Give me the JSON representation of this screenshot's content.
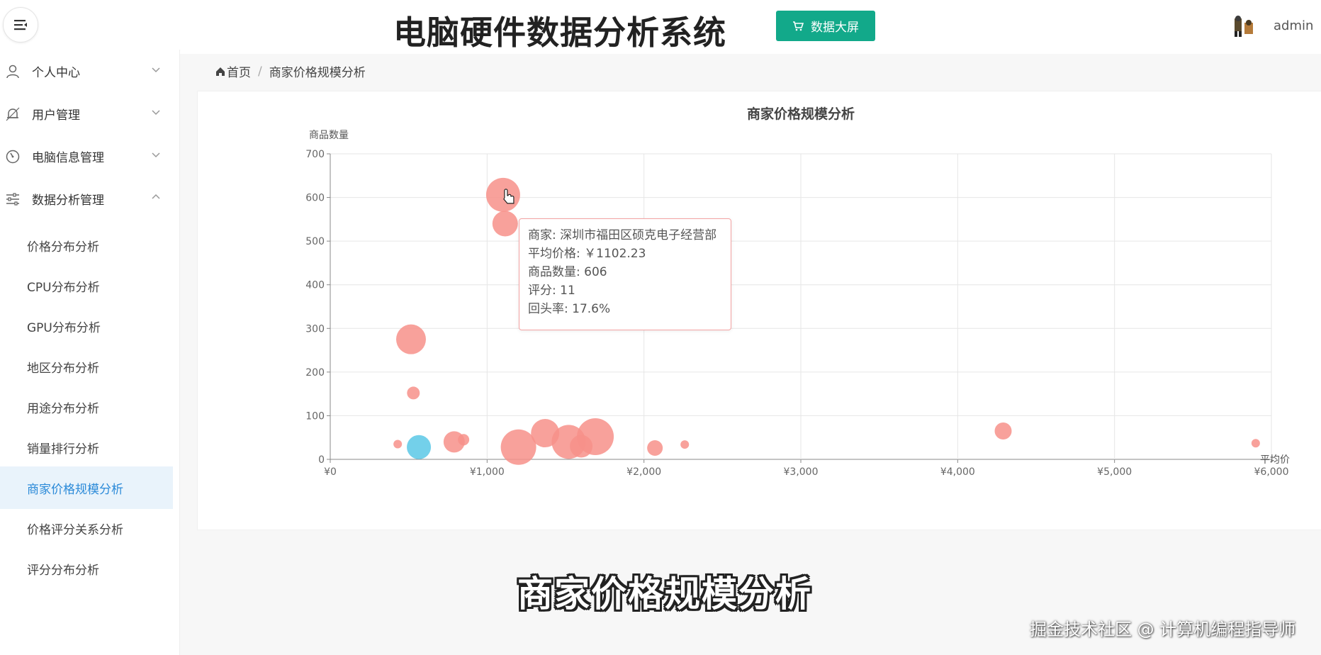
{
  "header": {
    "title": "电脑硬件数据分析系统",
    "bigscreen_label": "数据大屏",
    "username": "admin"
  },
  "sidebar": {
    "groups": [
      {
        "label": "个人中心",
        "icon": "user-icon",
        "expanded": false
      },
      {
        "label": "用户管理",
        "icon": "bell-icon",
        "expanded": false
      },
      {
        "label": "电脑信息管理",
        "icon": "gauge-icon",
        "expanded": false
      },
      {
        "label": "数据分析管理",
        "icon": "sliders-icon",
        "expanded": true
      }
    ],
    "items": [
      {
        "label": "价格分布分析"
      },
      {
        "label": "CPU分布分析"
      },
      {
        "label": "GPU分布分析"
      },
      {
        "label": "地区分布分析"
      },
      {
        "label": "用途分布分析"
      },
      {
        "label": "销量排行分析"
      },
      {
        "label": "商家价格规模分析",
        "active": true
      },
      {
        "label": "价格评分关系分析"
      },
      {
        "label": "评分分布分析"
      }
    ]
  },
  "breadcrumb": {
    "home": "首页",
    "current": "商家价格规模分析"
  },
  "colors": {
    "accent": "#12a98a",
    "bubble": "#f7908a",
    "highlight_bubble": "#5bc8e6",
    "active_menu": "#2b8ad8"
  },
  "chart_data": {
    "type": "scatter",
    "title": "商家价格规模分析",
    "xlabel": "平均价",
    "ylabel": "商品数量",
    "xlim": [
      0,
      6000
    ],
    "ylim": [
      0,
      700
    ],
    "xticks": [
      "¥0",
      "¥1,000",
      "¥2,000",
      "¥3,000",
      "¥4,000",
      "¥5,000",
      "¥6,000"
    ],
    "yticks": [
      "0",
      "100",
      "200",
      "300",
      "400",
      "500",
      "600",
      "700"
    ],
    "grid": true,
    "points": [
      {
        "x": 1102,
        "y": 606,
        "size": 24
      },
      {
        "x": 1115,
        "y": 540,
        "size": 18
      },
      {
        "x": 515,
        "y": 275,
        "size": 21
      },
      {
        "x": 530,
        "y": 152,
        "size": 9
      },
      {
        "x": 430,
        "y": 35,
        "size": 6
      },
      {
        "x": 565,
        "y": 28,
        "size": 17,
        "highlight": true
      },
      {
        "x": 790,
        "y": 40,
        "size": 15
      },
      {
        "x": 850,
        "y": 45,
        "size": 8
      },
      {
        "x": 1200,
        "y": 28,
        "size": 25
      },
      {
        "x": 1370,
        "y": 60,
        "size": 20
      },
      {
        "x": 1520,
        "y": 40,
        "size": 24
      },
      {
        "x": 1600,
        "y": 30,
        "size": 16
      },
      {
        "x": 1690,
        "y": 52,
        "size": 26
      },
      {
        "x": 2070,
        "y": 26,
        "size": 11
      },
      {
        "x": 2260,
        "y": 34,
        "size": 6
      },
      {
        "x": 4290,
        "y": 65,
        "size": 12
      },
      {
        "x": 5900,
        "y": 37,
        "size": 6
      }
    ],
    "tooltip": {
      "merchant_label": "商家: 深圳市福田区硕克电子经营部",
      "avg_price_label": "平均价格: ￥1102.23",
      "count_label": "商品数量: 606",
      "rating_label": "评分: 11",
      "return_rate_label": "回头率: 17.6%"
    }
  },
  "overlay": {
    "subtitle": "商家价格规模分析",
    "watermark": "掘金技术社区 @ 计算机编程指导师"
  }
}
